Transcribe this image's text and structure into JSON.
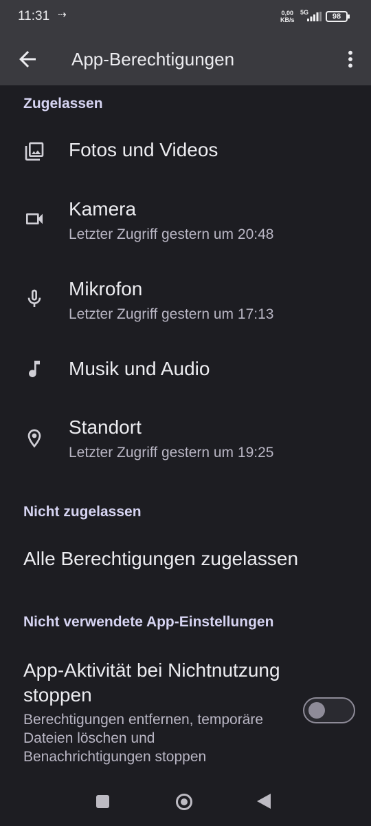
{
  "status": {
    "time": "11:31",
    "arrows": "⇢",
    "net_speed_value": "0,00",
    "net_speed_unit": "KB/s",
    "network": "5G",
    "battery": "98"
  },
  "appbar": {
    "title": "App-Berechtigungen",
    "back_icon": "arrow-back-icon",
    "more_icon": "more-vert-icon"
  },
  "sections": {
    "allowed": "Zugelassen",
    "not_allowed": "Nicht zugelassen",
    "unused": "Nicht verwendete App-Einstellungen"
  },
  "allowed_items": [
    {
      "icon": "photo-library-icon",
      "title": "Fotos und Videos",
      "subtitle": ""
    },
    {
      "icon": "videocam-icon",
      "title": "Kamera",
      "subtitle": "Letzter Zugriff gestern um 20:48"
    },
    {
      "icon": "mic-icon",
      "title": "Mikrofon",
      "subtitle": "Letzter Zugriff gestern um 17:13"
    },
    {
      "icon": "music-note-icon",
      "title": "Musik und Audio",
      "subtitle": ""
    },
    {
      "icon": "location-pin-icon",
      "title": "Standort",
      "subtitle": "Letzter Zugriff gestern um 19:25"
    }
  ],
  "not_allowed_item": "Alle Berechtigungen zugelassen",
  "unused_setting": {
    "title": "App-Aktivität bei Nichtnutzung stoppen",
    "subtitle": "Berechtigungen entfernen, temporäre Dateien löschen und Benachrichtigungen stoppen",
    "enabled": false
  },
  "colors": {
    "background": "#1d1d22",
    "bar": "#3a3a3f",
    "section_header": "#d6d4f2"
  }
}
